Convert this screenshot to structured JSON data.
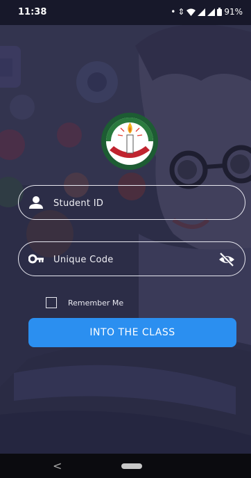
{
  "status_bar": {
    "time": "11:38",
    "battery": "91%"
  },
  "login": {
    "student_id_placeholder": "Student ID",
    "unique_code_placeholder": "Unique Code",
    "remember_label": "Remember Me",
    "submit_label": "INTO THE CLASS"
  },
  "colors": {
    "primary_button": "#2b8ff0",
    "background": "#2e2f4a"
  },
  "icons": {
    "student": "person-icon",
    "code": "key-icon",
    "visibility": "eye-off-icon"
  }
}
